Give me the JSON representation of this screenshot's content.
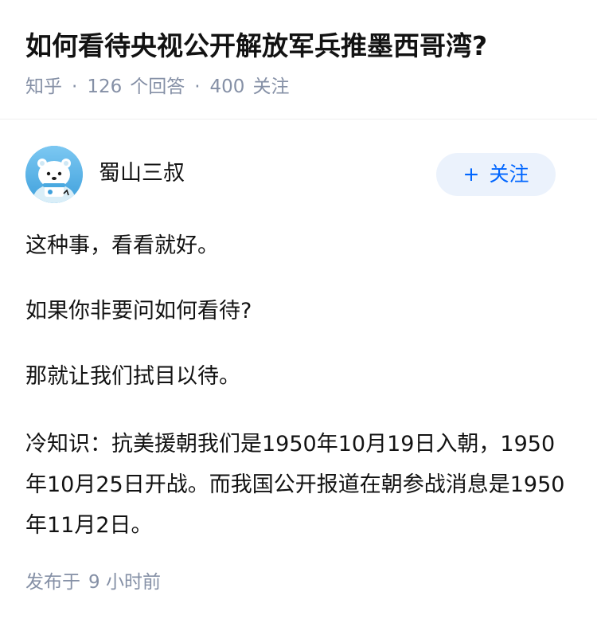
{
  "question": {
    "title": "如何看待央视公开解放军兵推墨西哥湾?",
    "source": "知乎",
    "separator": "·",
    "answer_count": "126",
    "answer_label": "个回答",
    "follower_count": "400",
    "follower_label": "关注"
  },
  "author": {
    "name": "蜀山三叔",
    "avatar_icon": "cartoon-bear-avatar-icon",
    "follow_plus": "+",
    "follow_label": "关注"
  },
  "answer": {
    "paragraphs": [
      "这种事，看看就好。",
      "如果你非要问如何看待?",
      "那就让我们拭目以待。",
      "冷知识：抗美援朝我们是1950年10月19日入朝，1950年10月25日开战。而我国公开报道在朝参战消息是1950年11月2日。"
    ]
  },
  "footer": {
    "publish_label": "发布于",
    "publish_time": "9 小时前"
  },
  "colors": {
    "title": "#121212",
    "meta": "#8590a6",
    "follow_bg": "#ebf2fc",
    "follow_text": "#0066ff",
    "avatar_bg": "#5bb6ea"
  }
}
